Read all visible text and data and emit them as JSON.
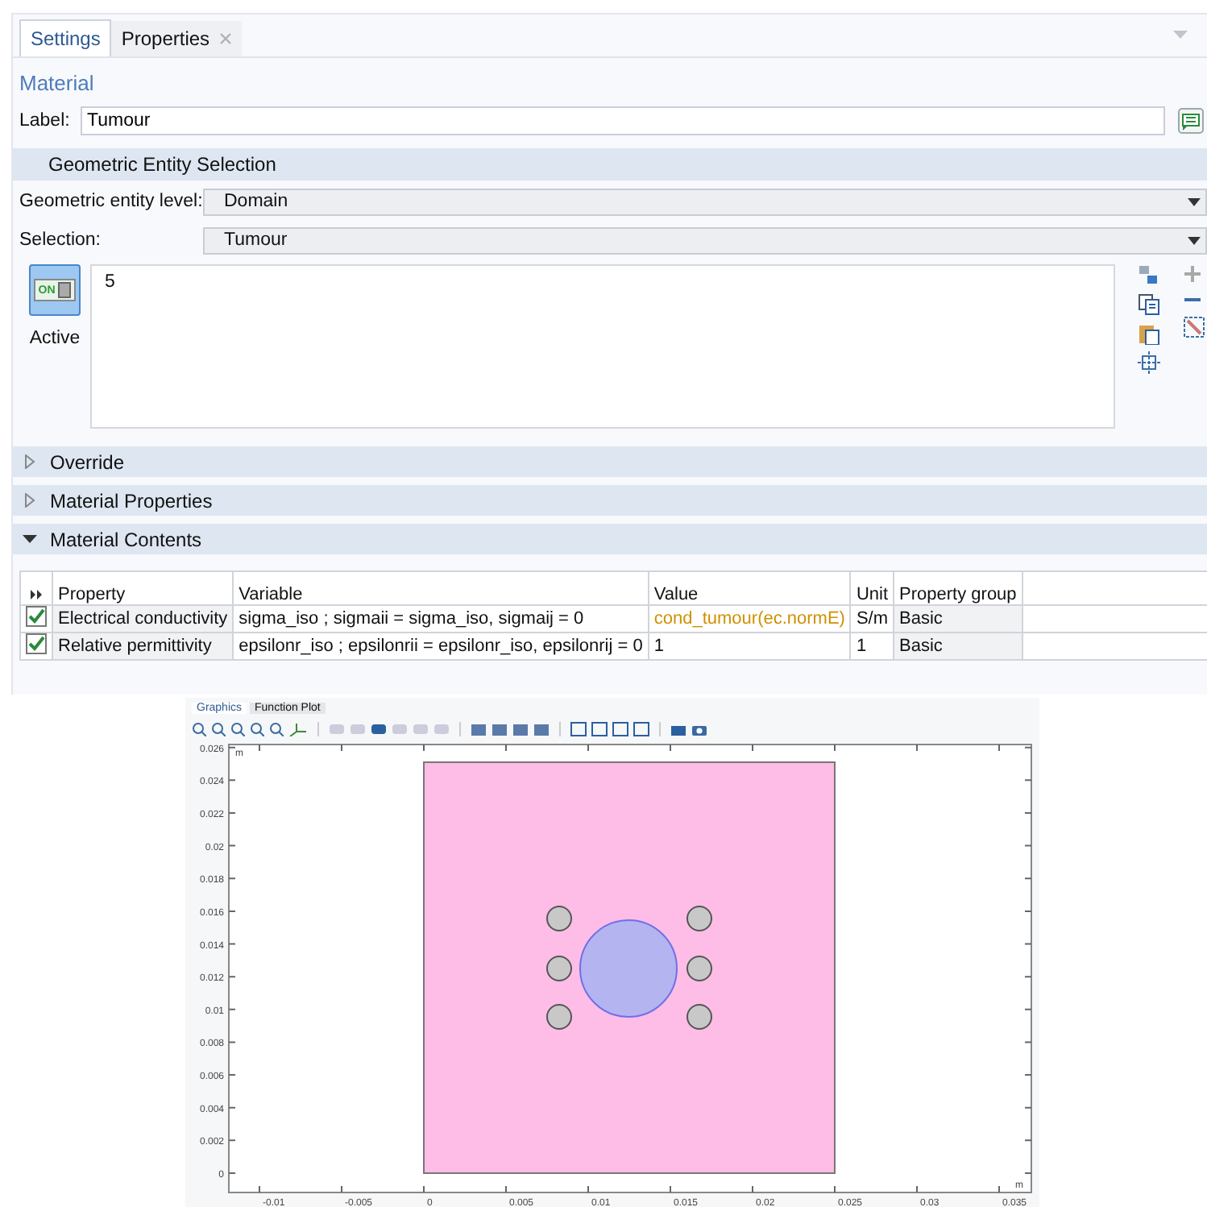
{
  "tabs": [
    {
      "label": "Settings",
      "selected": true,
      "closable": false
    },
    {
      "label": "Properties",
      "selected": false,
      "closable": true
    }
  ],
  "title": "Material",
  "label_field": {
    "caption": "Label:",
    "value": "Tumour"
  },
  "geometric_entity_selection": {
    "header": "Geometric Entity Selection",
    "dropdowns": [
      {
        "caption": "Geometric entity level:",
        "value": "Domain"
      },
      {
        "caption": "Selection:",
        "value": "Tumour"
      }
    ],
    "active": {
      "switch_text": "ON",
      "label": "Active",
      "on": true
    },
    "entities": [
      "5"
    ]
  },
  "sections": [
    {
      "title": "Override",
      "expanded": false
    },
    {
      "title": "Material Properties",
      "expanded": false
    },
    {
      "title": "Material Contents",
      "expanded": true
    }
  ],
  "table": {
    "columns": [
      "Property",
      "Variable",
      "Value",
      "Unit",
      "Property group"
    ],
    "rows": [
      {
        "checked": true,
        "property": "Electrical conductivity",
        "variable": "sigma_iso ; sigmaii = sigma_iso, sigmaij = 0",
        "value": "cond_tumour(ec.normE)",
        "value_is_function": true,
        "unit": "S/m",
        "group": "Basic"
      },
      {
        "checked": true,
        "property": "Relative permittivity",
        "variable": "epsilonr_iso ; epsilonrii = epsilonr_iso, epsilonrij = 0",
        "value": "1",
        "value_is_function": false,
        "unit": "1",
        "group": "Basic"
      }
    ]
  },
  "graphics": {
    "tabs": [
      {
        "label": "Graphics",
        "selected": true
      },
      {
        "label": "Function Plot",
        "selected": false
      }
    ],
    "y_unit": "m",
    "x_unit": "m",
    "x_ticks": [
      "-0.01",
      "-0.005",
      "0",
      "0.005",
      "0.01",
      "0.015",
      "0.02",
      "0.025",
      "0.03",
      "0.035"
    ],
    "y_ticks": [
      "0.026",
      "0.024",
      "0.022",
      "0.02",
      "0.018",
      "0.016",
      "0.014",
      "0.012",
      "0.01",
      "0.008",
      "0.006",
      "0.004",
      "0.002",
      "0"
    ]
  }
}
